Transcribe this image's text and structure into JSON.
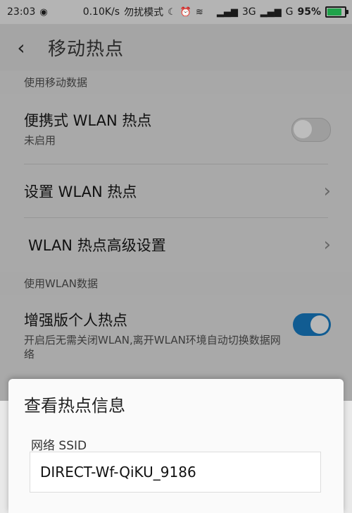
{
  "status_bar": {
    "time": "23:03",
    "speed": "0.10K/s",
    "mode": "勿扰模式",
    "signal1": "3G",
    "signal2": "G",
    "battery": "95%"
  },
  "app_bar": {
    "title": "移动热点"
  },
  "sections": {
    "mobile_data_header": "使用移动数据",
    "portable_wlan": {
      "title": "便携式 WLAN 热点",
      "subtitle": "未启用",
      "enabled": false
    },
    "setup_wlan": {
      "title": "设置 WLAN 热点"
    },
    "advanced_wlan": {
      "title": "WLAN 热点高级设置"
    },
    "wlan_data_header": "使用WLAN数据",
    "enhanced_hotspot": {
      "title": "增强版个人热点",
      "subtitle": "开启后无需关闭WLAN,离开WLAN环境自动切换数据网络",
      "enabled": true
    }
  },
  "dialog": {
    "title": "查看热点信息",
    "ssid_label": "网络 SSID",
    "ssid_value": "DIRECT-Wf-QiKU_9186"
  },
  "colors": {
    "accent": "#115c92",
    "battery": "#1fa34a"
  }
}
